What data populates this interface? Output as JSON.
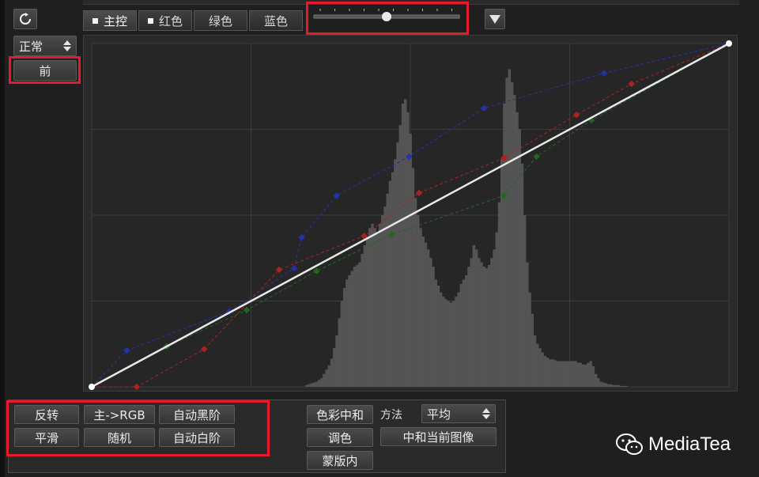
{
  "toolbar": {
    "reset_icon": "refresh-icon",
    "tabs": [
      {
        "label": "主控",
        "active": true,
        "has_dot": true
      },
      {
        "label": "红色",
        "active": false,
        "has_dot": true
      },
      {
        "label": "绿色",
        "active": false,
        "has_dot": false
      },
      {
        "label": "蓝色",
        "active": false,
        "has_dot": false
      }
    ],
    "slider_value": 0.5,
    "menu_icon": "triangle-down-icon"
  },
  "left": {
    "mode_select": "正常",
    "before_button": "前"
  },
  "chart_data": {
    "type": "area",
    "grid": true,
    "histogram": [
      0,
      0,
      0,
      0,
      0,
      0,
      0,
      0,
      0,
      0,
      0,
      0,
      0,
      0,
      0,
      0,
      0,
      0,
      0,
      0,
      0,
      0,
      0,
      0,
      0,
      0,
      0,
      0,
      0,
      0,
      0,
      0,
      0,
      0,
      0,
      0,
      0,
      0,
      0,
      0,
      0,
      0,
      0,
      0,
      0,
      0,
      0,
      0,
      0,
      0,
      0,
      0,
      0,
      0,
      0,
      0,
      0,
      0,
      0,
      0,
      0,
      0,
      0,
      0,
      0,
      0,
      0,
      0,
      0,
      0,
      0,
      0,
      0,
      0,
      0,
      0,
      0,
      0,
      0,
      0,
      0,
      0,
      0,
      0,
      2,
      3,
      4,
      5,
      6,
      8,
      10,
      15,
      20,
      25,
      33,
      45,
      60,
      80,
      100,
      115,
      125,
      130,
      135,
      140,
      142,
      145,
      155,
      165,
      175,
      185,
      190,
      185,
      178,
      190,
      200,
      210,
      225,
      240,
      250,
      265,
      285,
      305,
      330,
      335,
      320,
      295,
      255,
      220,
      200,
      185,
      175,
      168,
      160,
      150,
      140,
      125,
      118,
      110,
      105,
      102,
      100,
      98,
      100,
      105,
      110,
      120,
      125,
      130,
      140,
      150,
      165,
      160,
      150,
      145,
      140,
      138,
      142,
      150,
      160,
      180,
      215,
      265,
      330,
      360,
      370,
      355,
      340,
      320,
      300,
      260,
      200,
      145,
      110,
      85,
      60,
      50,
      45,
      40,
      36,
      34,
      32,
      32,
      31,
      30,
      30,
      30,
      30,
      30,
      30,
      30,
      30,
      28,
      28,
      26,
      26,
      28,
      30,
      24,
      15,
      10,
      6,
      5,
      4,
      3,
      3,
      2,
      2,
      2,
      1,
      1,
      1,
      0,
      0,
      0,
      0,
      0,
      0,
      0,
      0,
      0,
      0,
      0,
      0,
      0,
      0,
      0,
      0,
      0,
      0,
      0,
      0,
      0,
      0,
      0,
      0,
      0,
      0,
      0,
      0,
      0,
      0,
      0,
      0,
      0,
      0,
      0,
      0,
      0,
      0,
      0,
      0
    ],
    "xlim": [
      0,
      255
    ],
    "ylim": [
      0,
      255
    ],
    "series": [
      {
        "color": "#e8e8e8",
        "style": "solid",
        "points": [
          [
            0,
            0
          ],
          [
            255,
            255
          ]
        ]
      },
      {
        "color": "#2233aa",
        "style": "dashed",
        "points": [
          [
            0,
            0
          ],
          [
            14,
            27
          ],
          [
            55,
            56
          ],
          [
            81,
            88
          ],
          [
            84,
            111
          ],
          [
            98,
            142
          ],
          [
            127,
            171
          ],
          [
            157,
            207
          ],
          [
            205,
            233
          ],
          [
            255,
            255
          ]
        ]
      },
      {
        "color": "#aa2222",
        "style": "dashed",
        "points": [
          [
            0,
            0
          ],
          [
            18,
            0
          ],
          [
            45,
            28
          ],
          [
            75,
            87
          ],
          [
            109,
            112
          ],
          [
            131,
            144
          ],
          [
            165,
            170
          ],
          [
            194,
            202
          ],
          [
            216,
            225
          ],
          [
            255,
            255
          ]
        ]
      },
      {
        "color": "#226622",
        "style": "dashed",
        "points": [
          [
            0,
            0
          ],
          [
            30,
            30
          ],
          [
            62,
            57
          ],
          [
            90,
            86
          ],
          [
            120,
            113
          ],
          [
            165,
            142
          ],
          [
            178,
            171
          ],
          [
            200,
            198
          ],
          [
            255,
            255
          ]
        ]
      }
    ]
  },
  "bottom": {
    "buttons": [
      "反转",
      "主->RGB",
      "自动黑阶",
      "平滑",
      "随机",
      "自动白阶"
    ],
    "neutral_button": "色彩中和",
    "tone_button": "调色",
    "mask_button": "蒙版内",
    "method_label": "方法",
    "method_value": "平均",
    "neutralize_button": "中和当前图像"
  },
  "watermark": {
    "text": "MediaTea",
    "icon": "wechat-icon"
  }
}
